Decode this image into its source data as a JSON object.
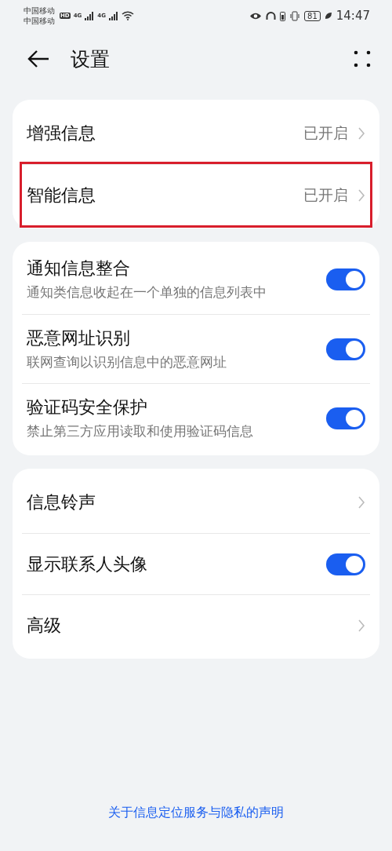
{
  "status_bar": {
    "carriers": [
      "中国移动",
      "中国移动"
    ],
    "hd_badge": "HD",
    "network_labels": [
      "4G",
      "4G"
    ],
    "battery": "81",
    "time": "14:47"
  },
  "header": {
    "title": "设置"
  },
  "groups": [
    {
      "items": [
        {
          "kind": "link",
          "title": "增强信息",
          "value": "已开启",
          "highlighted": false
        },
        {
          "kind": "link",
          "title": "智能信息",
          "value": "已开启",
          "highlighted": true
        }
      ]
    },
    {
      "items": [
        {
          "kind": "toggle",
          "title": "通知信息整合",
          "subtitle": "通知类信息收起在一个单独的信息列表中",
          "on": true
        },
        {
          "kind": "toggle",
          "title": "恶意网址识别",
          "subtitle": "联网查询以识别信息中的恶意网址",
          "on": true
        },
        {
          "kind": "toggle",
          "title": "验证码安全保护",
          "subtitle": "禁止第三方应用读取和使用验证码信息",
          "on": true
        }
      ]
    },
    {
      "items": [
        {
          "kind": "link",
          "title": "信息铃声",
          "highlighted": false
        },
        {
          "kind": "toggle",
          "title": "显示联系人头像",
          "on": true
        },
        {
          "kind": "link",
          "title": "高级",
          "highlighted": false
        }
      ]
    }
  ],
  "footer": {
    "link": "关于信息定位服务与隐私的声明"
  }
}
